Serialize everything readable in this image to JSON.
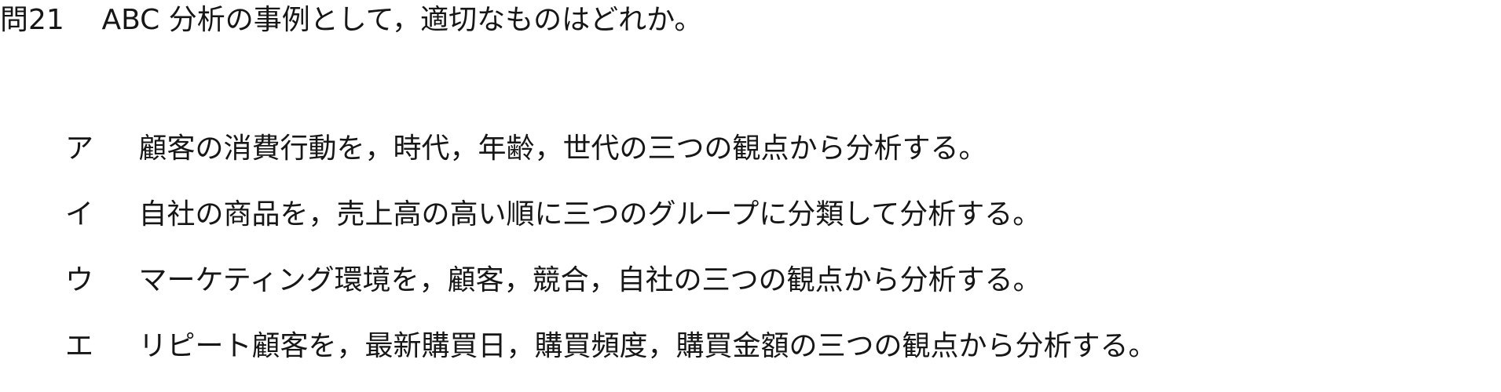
{
  "question": {
    "number": "問21",
    "text": "ABC 分析の事例として，適切なものはどれか。"
  },
  "choices": [
    {
      "label": "ア",
      "text": "顧客の消費行動を，時代，年齢，世代の三つの観点から分析する。"
    },
    {
      "label": "イ",
      "text": "自社の商品を，売上高の高い順に三つのグループに分類して分析する。"
    },
    {
      "label": "ウ",
      "text": "マーケティング環境を，顧客，競合，自社の三つの観点から分析する。"
    },
    {
      "label": "エ",
      "text": "リピート顧客を，最新購買日，購買頻度，購買金額の三つの観点から分析する。"
    }
  ]
}
